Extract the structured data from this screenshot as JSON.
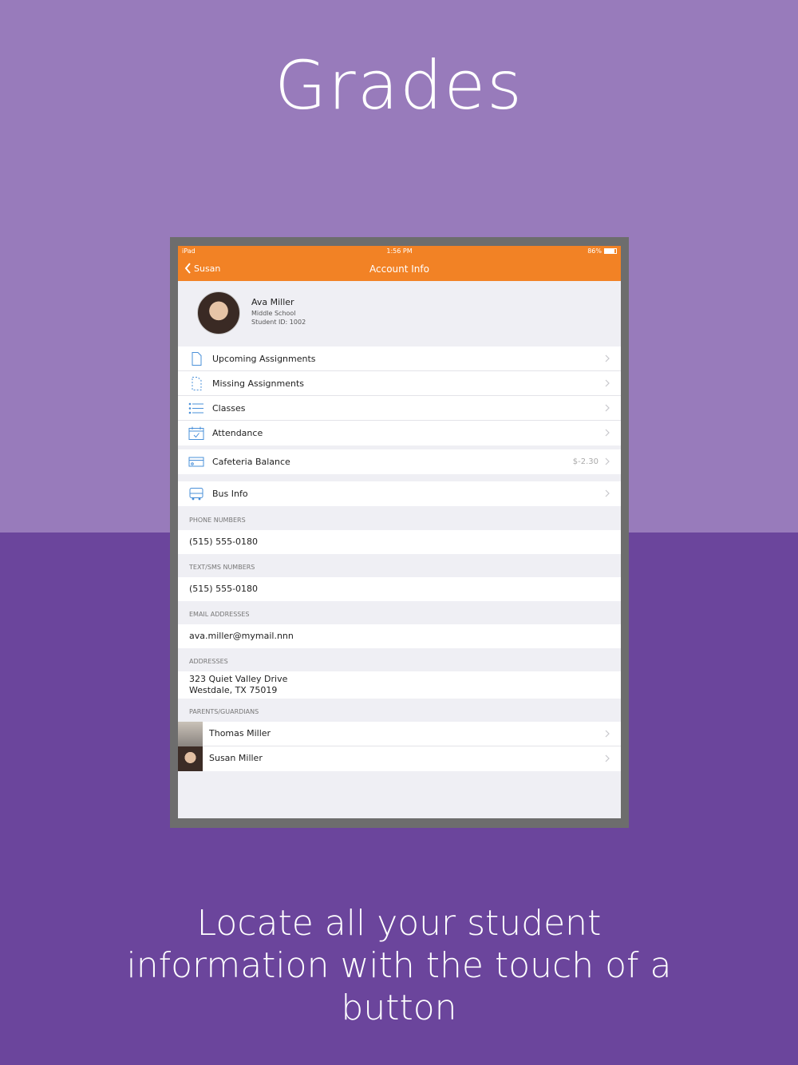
{
  "headline": "Grades",
  "caption": "Locate all your student information with the touch of a button",
  "colors": {
    "accent": "#f28225",
    "bg_top": "#987bbb",
    "bg_bottom": "#6b459c",
    "link_icon": "#4a90d9"
  },
  "status_bar": {
    "device": "iPad",
    "time": "1:56 PM",
    "battery": "86%",
    "battery_level": 0.86
  },
  "nav": {
    "back_label": "Susan",
    "title": "Account Info"
  },
  "student": {
    "name": "Ava Miller",
    "school": "Middle School",
    "student_id": "Student ID: 1002"
  },
  "menu": {
    "upcoming": "Upcoming Assignments",
    "missing": "Missing Assignments",
    "classes": "Classes",
    "attendance": "Attendance",
    "cafeteria": "Cafeteria Balance",
    "cafeteria_value": "$-2.30",
    "bus": "Bus Info"
  },
  "sections": {
    "phone_header": "PHONE NUMBERS",
    "phone": "(515) 555-0180",
    "sms_header": "TEXT/SMS NUMBERS",
    "sms": "(515) 555-0180",
    "email_header": "EMAIL ADDRESSES",
    "email": "ava.miller@mymail.nnn",
    "address_header": "ADDRESSES",
    "address_line1": "323 Quiet Valley Drive",
    "address_line2": "Westdale, TX 75019",
    "guardians_header": "PARENTS/GUARDIANS"
  },
  "guardians": [
    "Thomas Miller",
    "Susan Miller"
  ]
}
